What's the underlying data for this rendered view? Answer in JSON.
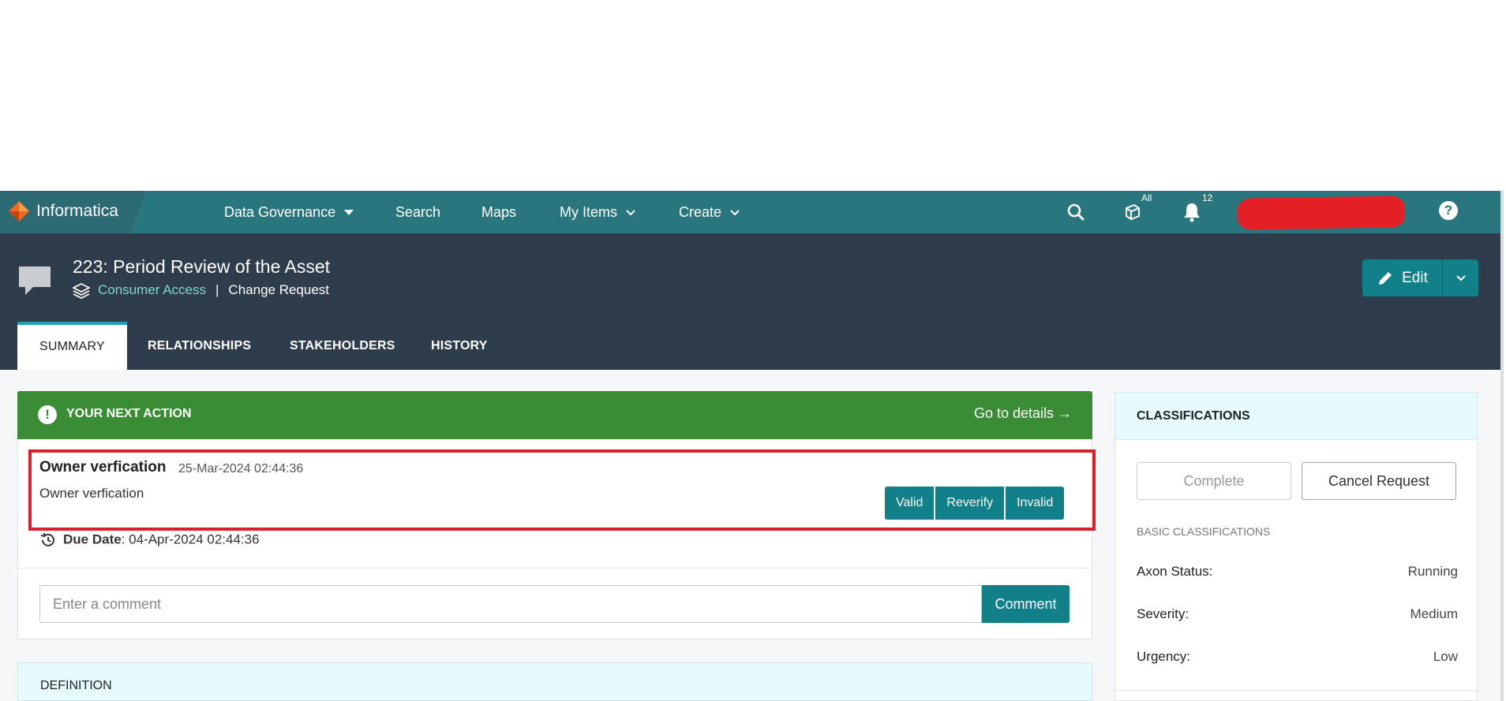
{
  "nav": {
    "brand": "Informatica",
    "items": [
      {
        "label": "Data Governance"
      },
      {
        "label": "Search"
      },
      {
        "label": "Maps"
      },
      {
        "label": "My Items"
      },
      {
        "label": "Create"
      }
    ],
    "workspace_badge": "All",
    "notification_count": "12",
    "help_label": "?"
  },
  "header": {
    "title": "223: Period Review of the Asset",
    "asset_link": "Consumer Access",
    "separator": "|",
    "type": "Change Request",
    "edit_label": "Edit"
  },
  "tabs": [
    {
      "label": "SUMMARY",
      "active": true
    },
    {
      "label": "RELATIONSHIPS"
    },
    {
      "label": "STAKEHOLDERS"
    },
    {
      "label": "HISTORY"
    }
  ],
  "next_action": {
    "label": "YOUR NEXT ACTION",
    "alert_icon": "!",
    "goto": "Go to details →",
    "task_title": "Owner verfication",
    "task_date": "25-Mar-2024 02:44:36",
    "task_desc": "Owner verfication",
    "buttons": [
      "Valid",
      "Reverify",
      "Invalid"
    ],
    "due_label": "Due Date",
    "due_value": ": 04-Apr-2024 02:44:36",
    "comment_placeholder": "Enter a comment",
    "comment_button": "Comment"
  },
  "definition": {
    "label": "DEFINITION"
  },
  "classifications": {
    "label": "CLASSIFICATIONS",
    "complete_label": "Complete",
    "cancel_label": "Cancel Request",
    "basic_label": "BASIC CLASSIFICATIONS",
    "props": [
      {
        "label": "Axon Status:",
        "value": "Running"
      },
      {
        "label": "Severity:",
        "value": "Medium"
      },
      {
        "label": "Urgency:",
        "value": "Low"
      }
    ]
  },
  "colors": {
    "nav_bg": "#29767e",
    "header_bg": "#2f3c4c",
    "action_green": "#3a8d35",
    "button_teal": "#118089",
    "highlight_red": "#d6212d"
  }
}
